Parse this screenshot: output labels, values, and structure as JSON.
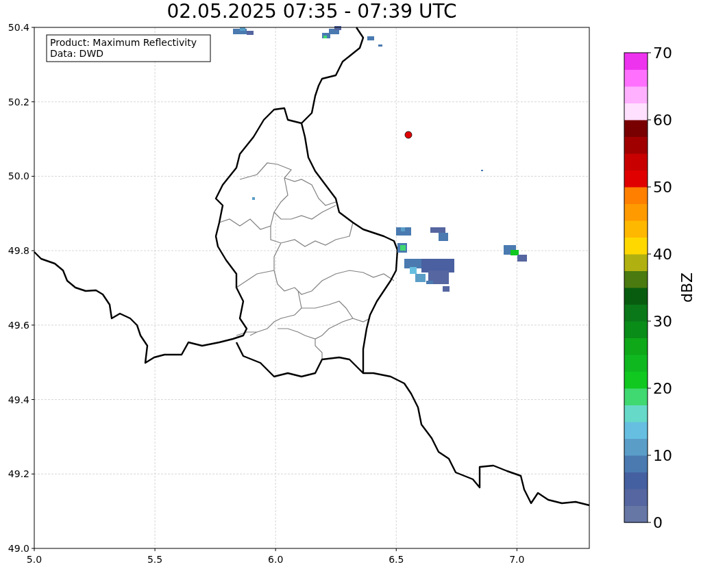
{
  "title": "02.05.2025 07:35 - 07:39 UTC",
  "info_box": {
    "lines": [
      "Product: Maximum Reflectivity",
      "Data: DWD"
    ]
  },
  "map": {
    "x_ticks": [
      "5.0",
      "5.5",
      "6.0",
      "6.5",
      "7.0"
    ],
    "y_ticks": [
      "50.4",
      "50.2",
      "50.0",
      "49.8",
      "49.6",
      "49.4",
      "49.2",
      "49.0"
    ]
  },
  "colorbar": {
    "label": "dBZ",
    "ticks": [
      "70",
      "60",
      "50",
      "40",
      "30",
      "20",
      "10",
      "0"
    ],
    "segments": [
      {
        "color": "#6677a6"
      },
      {
        "color": "#5566a0"
      },
      {
        "color": "#4560a0"
      },
      {
        "color": "#4a7ab0"
      },
      {
        "color": "#5a9ec8"
      },
      {
        "color": "#66bfe0"
      },
      {
        "color": "#66d9c8"
      },
      {
        "color": "#40d870"
      },
      {
        "color": "#10c820"
      },
      {
        "color": "#10b820"
      },
      {
        "color": "#0ea818"
      },
      {
        "color": "#0a8c18"
      },
      {
        "color": "#0a7818"
      },
      {
        "color": "#085c10"
      },
      {
        "color": "#4a7a10"
      },
      {
        "color": "#b0b010"
      },
      {
        "color": "#ffd800"
      },
      {
        "color": "#ffb800"
      },
      {
        "color": "#ff9a00"
      },
      {
        "color": "#ff7f00"
      },
      {
        "color": "#e00000"
      },
      {
        "color": "#c80000"
      },
      {
        "color": "#a00000"
      },
      {
        "color": "#780000"
      },
      {
        "color": "#ffe0ff"
      },
      {
        "color": "#ffb0ff"
      },
      {
        "color": "#ff70ff"
      },
      {
        "color": "#ee33ee"
      }
    ]
  }
}
